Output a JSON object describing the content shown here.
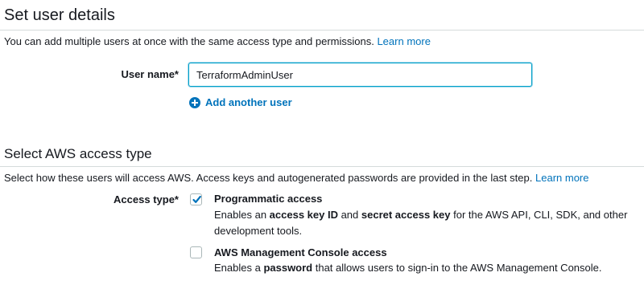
{
  "user_details": {
    "title": "Set user details",
    "description": "You can add multiple users at once with the same access type and permissions.",
    "learn_more": "Learn more",
    "user_name_label": "User name*",
    "user_name_value": "TerraformAdminUser",
    "add_user_label": "Add another user"
  },
  "access_type": {
    "title": "Select AWS access type",
    "description": "Select how these users will access AWS. Access keys and autogenerated passwords are provided in the last step.",
    "learn_more": "Learn more",
    "label": "Access type*",
    "options": [
      {
        "title": "Programmatic access",
        "checked": true,
        "desc_1": "Enables an ",
        "desc_bold_1": "access key ID",
        "desc_2": " and ",
        "desc_bold_2": "secret access key",
        "desc_3": " for the AWS API, CLI, SDK, and other development tools."
      },
      {
        "title": "AWS Management Console access",
        "checked": false,
        "desc_1": "Enables a ",
        "desc_bold_1": "password",
        "desc_2": " that allows users to sign-in to the AWS Management Console."
      }
    ]
  },
  "colors": {
    "link": "#0073bb",
    "focus_border": "#00a1c9",
    "divider": "#d5dbdb"
  },
  "icons": {
    "add_user": "plus-circle-icon",
    "check": "checkmark-icon"
  }
}
